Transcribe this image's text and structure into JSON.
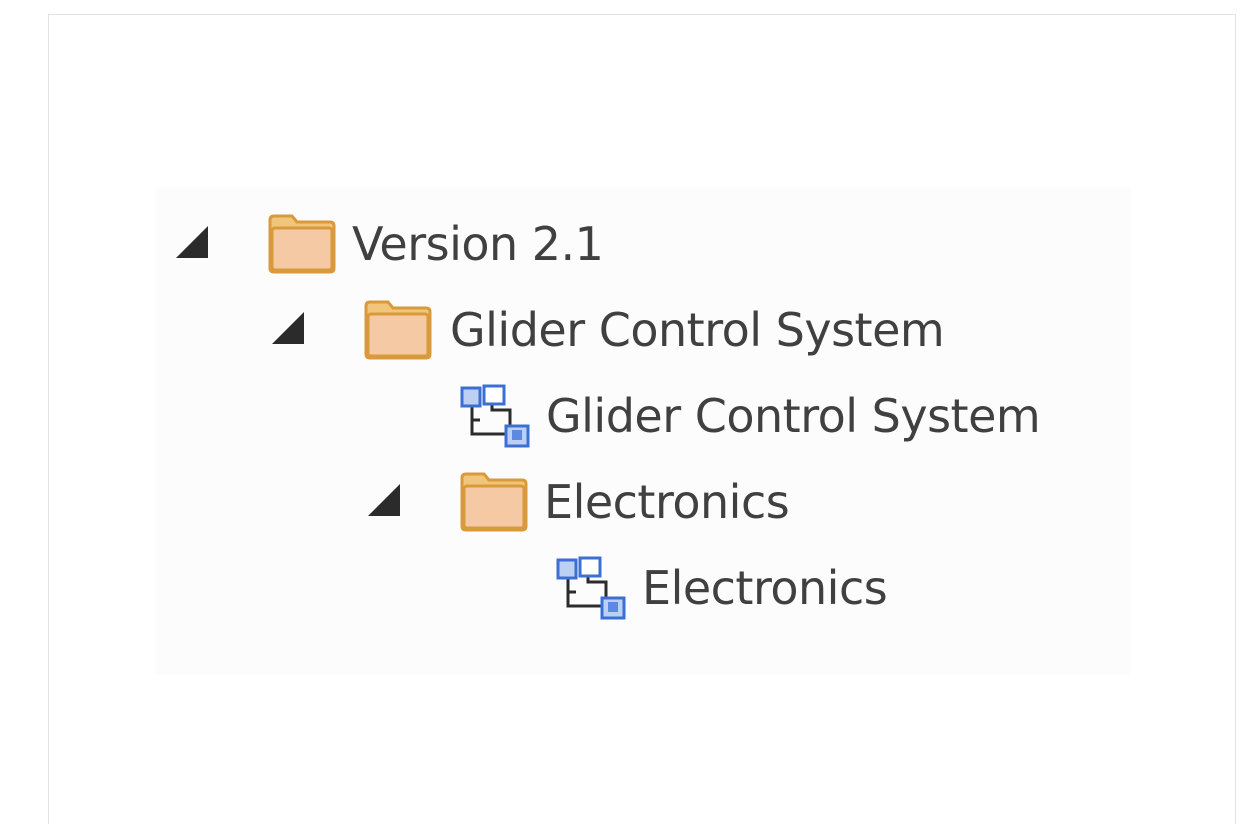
{
  "tree": {
    "items": [
      {
        "label": "Version 2.1",
        "type": "package",
        "expanded": true,
        "icon": "folder-icon"
      },
      {
        "label": "Glider Control System",
        "type": "package",
        "expanded": true,
        "icon": "folder-icon"
      },
      {
        "label": "Glider Control System",
        "type": "diagram",
        "icon": "diagram-icon"
      },
      {
        "label": "Electronics",
        "type": "package",
        "expanded": true,
        "icon": "folder-icon"
      },
      {
        "label": "Electronics",
        "type": "diagram",
        "icon": "diagram-icon"
      }
    ]
  },
  "colors": {
    "folder_fill": "#f4c9a4",
    "folder_border": "#d89a3a",
    "diagram_node": "#3b6fd4",
    "text": "#404040"
  }
}
